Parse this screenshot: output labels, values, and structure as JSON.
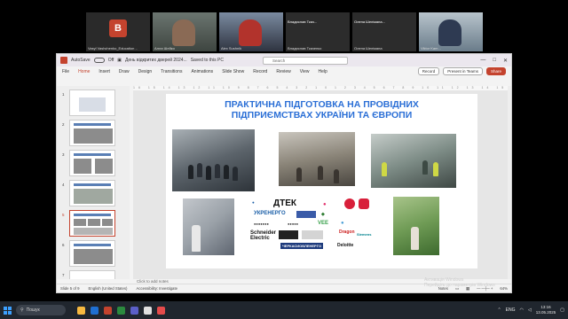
{
  "call": {
    "tiles": [
      {
        "name": "Vasyl Vashchenko_Education ..",
        "letter": "B",
        "kind": "avatar"
      },
      {
        "name": "Алла Шейко",
        "kind": "cam1"
      },
      {
        "name": "Alex Sushnik",
        "kind": "cam2"
      },
      {
        "name": "Владислав Ткач...",
        "sub": "Владислав Ткаченко",
        "kind": "plain"
      },
      {
        "name": "Олена Шелімана...",
        "sub": "Олена Шелімана",
        "kind": "plain"
      },
      {
        "name": "Viktor Kam...",
        "kind": "cam3"
      }
    ]
  },
  "window": {
    "autosave": "AutoSave",
    "toggle": "Off",
    "doc_title": "День відкритих дверей 2024...",
    "saved": "Saved to this PC",
    "search_placeholder": "Search",
    "menus": [
      "File",
      "Home",
      "Insert",
      "Draw",
      "Design",
      "Transitions",
      "Animations",
      "Slide Show",
      "Record",
      "Review",
      "View",
      "Help"
    ],
    "buttons": {
      "record": "Record",
      "present": "Present in Teams",
      "share": "Share"
    }
  },
  "slides": {
    "numbers": [
      "1",
      "2",
      "3",
      "4",
      "5",
      "6",
      "7"
    ],
    "active": "5"
  },
  "slide": {
    "title_line1": "ПРАКТИЧНА ПІДГОТОВКА НА ПРОВІДНИХ",
    "title_line2": "ПІДПРИЄМСТВАХ УКРАЇНИ ТА ЄВРОПИ",
    "logos": [
      "ДТЕК",
      "УКРЕНЕРГО",
      "Schneider Electric",
      "ЧЕРКАСИОБЛЕНЕРГО",
      "VEE",
      "Siemens",
      "Deloitte",
      "Dragon"
    ]
  },
  "notes_placeholder": "Click to add notes",
  "status": {
    "slide": "Slide 5 of 9",
    "lang": "English (United States)",
    "access": "Accessibility: Investigate",
    "notes": "Notes",
    "zoom": "64%"
  },
  "watermark": {
    "line1": "Активація Windows",
    "line2": "Перейдіть до параметрів Windows"
  },
  "taskbar": {
    "search": "Пошук",
    "lang": "ENG",
    "time": "13:16",
    "date": "13.05.2025",
    "colors": [
      "#f7b940",
      "#1f6fd1",
      "#c4432e",
      "#2b8a3e",
      "#5b5fc7",
      "#e0e0e0",
      "#e54b4b"
    ]
  }
}
